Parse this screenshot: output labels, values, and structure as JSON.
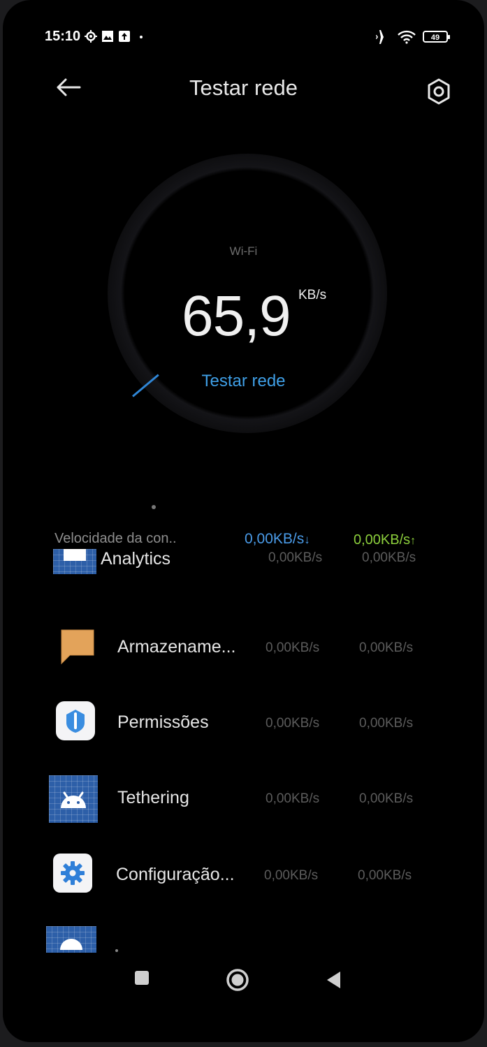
{
  "status_bar": {
    "time": "15:10",
    "battery": "49",
    "icons": [
      "settings-gear-icon",
      "photo-icon",
      "upload-icon",
      "dot-icon",
      "airplane-icon",
      "wifi-icon",
      "battery-icon"
    ]
  },
  "header": {
    "title": "Testar rede",
    "back_icon": "arrow-left-icon",
    "settings_icon": "hexagon-settings-icon"
  },
  "gauge": {
    "network_type": "Wi-Fi",
    "speed": "65,9",
    "unit": "KB/s",
    "test_label": "Testar rede"
  },
  "total": {
    "label": "Velocidade da con..",
    "download": "0,00KB/s",
    "download_arrow": "↓",
    "upload": "0,00KB/s",
    "upload_arrow": "↑"
  },
  "apps": [
    {
      "name": "Analytics",
      "download": "0,00KB/s",
      "upload": "0,00KB/s",
      "icon": "analytics-icon"
    },
    {
      "name": "Armazename...",
      "download": "0,00KB/s",
      "upload": "0,00KB/s",
      "icon": "storage-icon"
    },
    {
      "name": "Permissões",
      "download": "0,00KB/s",
      "upload": "0,00KB/s",
      "icon": "permissions-icon"
    },
    {
      "name": "Tethering",
      "download": "0,00KB/s",
      "upload": "0,00KB/s",
      "icon": "android-icon"
    },
    {
      "name": "Configuração...",
      "download": "0,00KB/s",
      "upload": "0,00KB/s",
      "icon": "gear-icon"
    }
  ],
  "colors": {
    "accent_blue": "#3f9fe6",
    "upload_green": "#8ccf3c",
    "background": "#000000"
  }
}
